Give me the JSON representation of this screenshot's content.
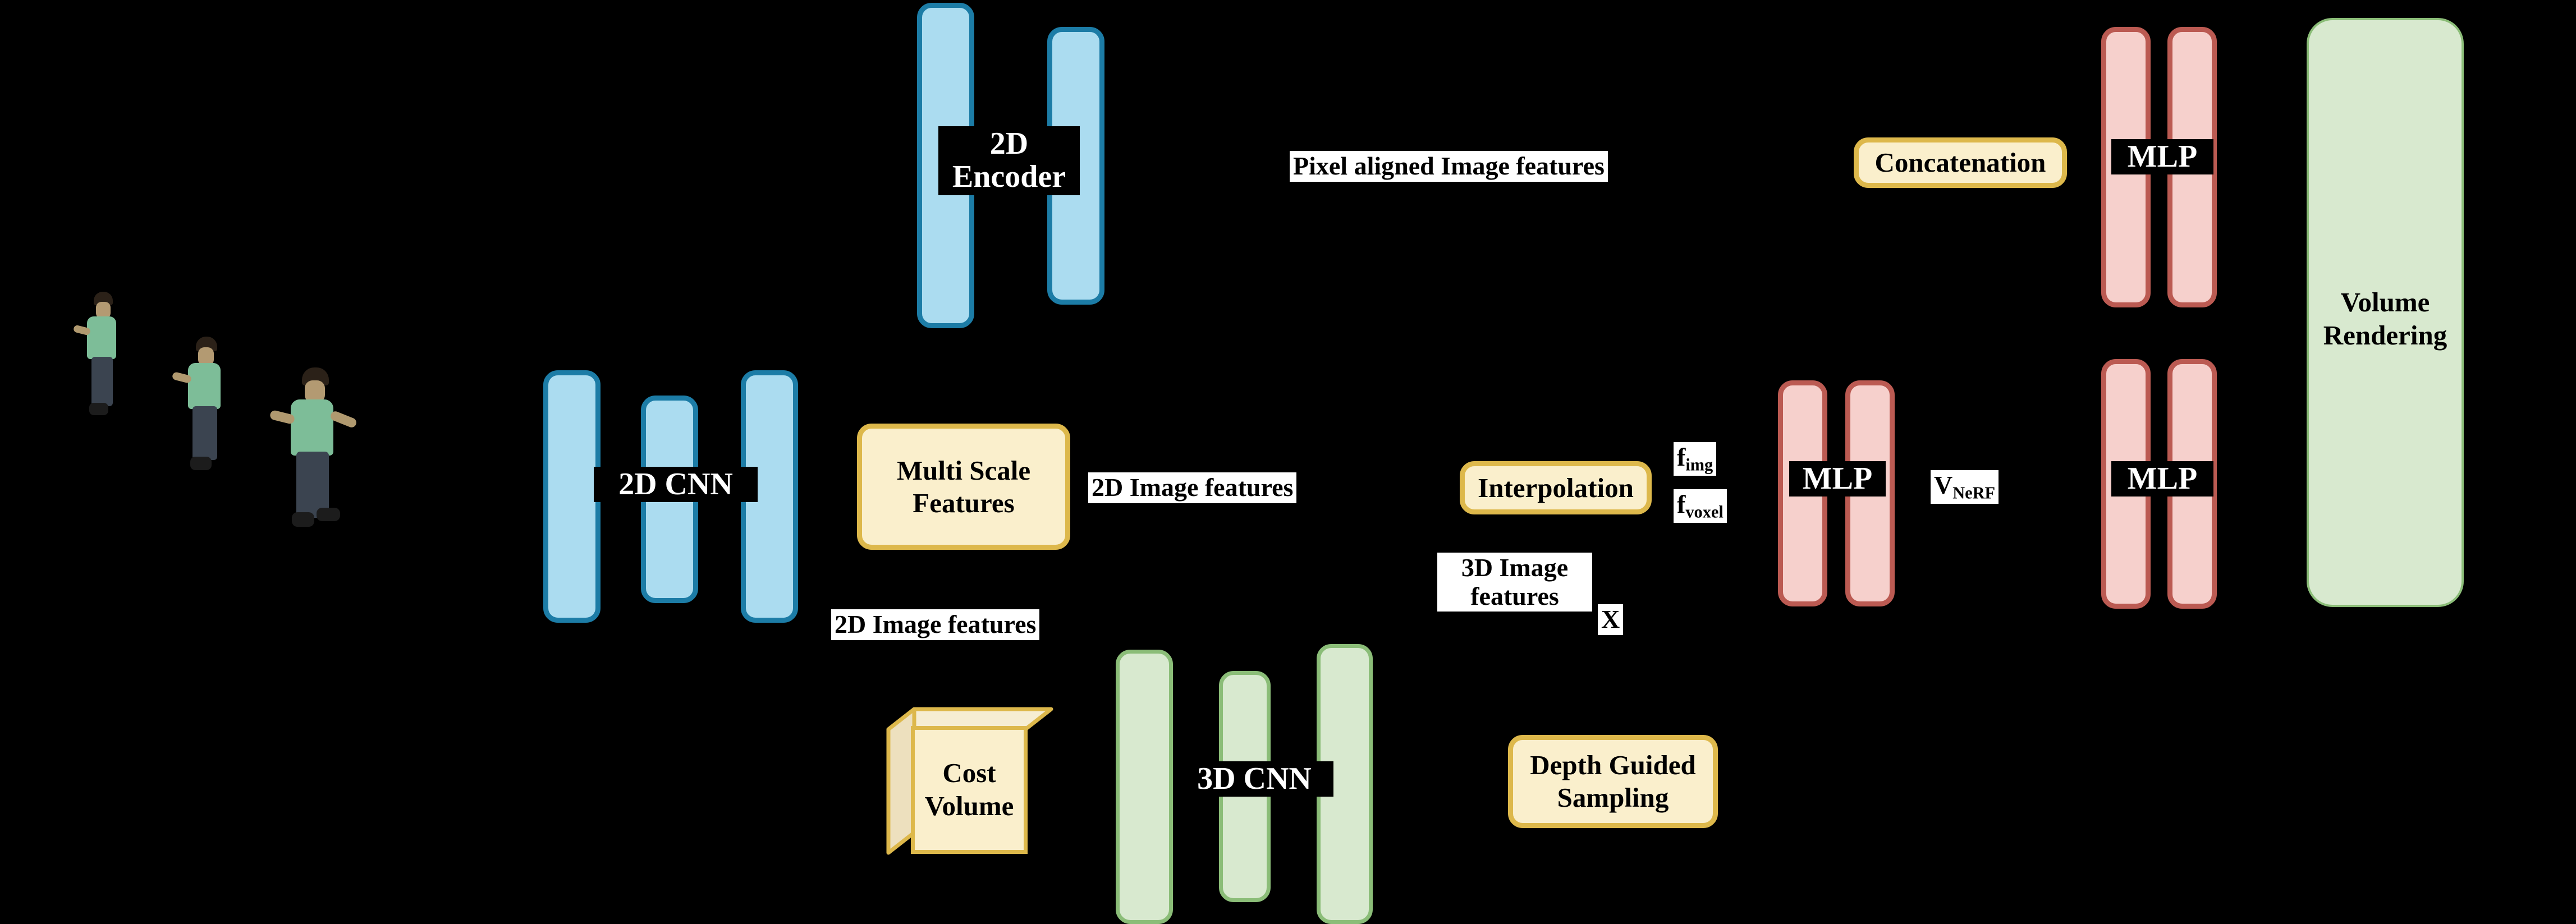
{
  "diagram": {
    "title": "Generalizable human NeRF pipeline architecture",
    "background_color": "#000000",
    "palette": {
      "blue_fill": "#ABDCF0",
      "blue_border": "#1C7CA6",
      "pink_fill": "#F6D0CC",
      "pink_border": "#BB5A52",
      "green_fill": "#D8E9CF",
      "green_border": "#8BBD78",
      "cream_fill": "#FAEFCC",
      "gold_border": "#DDB84B",
      "label_text_on_dark": "#FFFFFF",
      "label_text_on_light": "#000000"
    }
  },
  "inputs": {
    "figures": [
      {
        "name": "source-view-1"
      },
      {
        "name": "source-view-2"
      },
      {
        "name": "source-view-3"
      }
    ]
  },
  "modules": {
    "encoder_2d": {
      "label": "2D\nEncoder",
      "line1": "2D",
      "line2": "Encoder",
      "color": "blue",
      "bars": 2
    },
    "cnn_2d": {
      "label": "2D CNN",
      "color": "blue",
      "bars": 3
    },
    "cnn_3d": {
      "label": "3D CNN",
      "color": "green",
      "bars": 3
    },
    "mlp_top": {
      "label": "MLP",
      "color": "pink",
      "bars": 2
    },
    "mlp_mid": {
      "label": "MLP",
      "color": "pink",
      "bars": 2
    },
    "mlp_bottom": {
      "label": "MLP",
      "color": "pink",
      "bars": 2
    },
    "volume_rendering": {
      "line1": "Volume",
      "line2": "Rendering",
      "color": "green"
    }
  },
  "operations": {
    "multi_scale_features": {
      "line1": "Multi Scale",
      "line2": "Features"
    },
    "cost_volume": {
      "line1": "Cost",
      "line2": "Volume"
    },
    "interpolation": {
      "label": "Interpolation"
    },
    "depth_guided_sampling": {
      "line1": "Depth Guided",
      "line2": "Sampling"
    },
    "concatenation": {
      "label": "Concatenation"
    }
  },
  "annotations": {
    "pixel_aligned_image_features": "Pixel aligned Image features",
    "image_features_2d_top": "2D Image features",
    "image_features_2d_bottom": "2D Image features",
    "image_features_3d": {
      "line1": "3D Image",
      "line2": "features"
    },
    "point_x": "X",
    "f_img": {
      "base": "f",
      "sub": "img"
    },
    "f_voxel": {
      "base": "f",
      "sub": "voxel"
    },
    "v_nerf": {
      "base": "V",
      "sub": "NeRF"
    }
  }
}
